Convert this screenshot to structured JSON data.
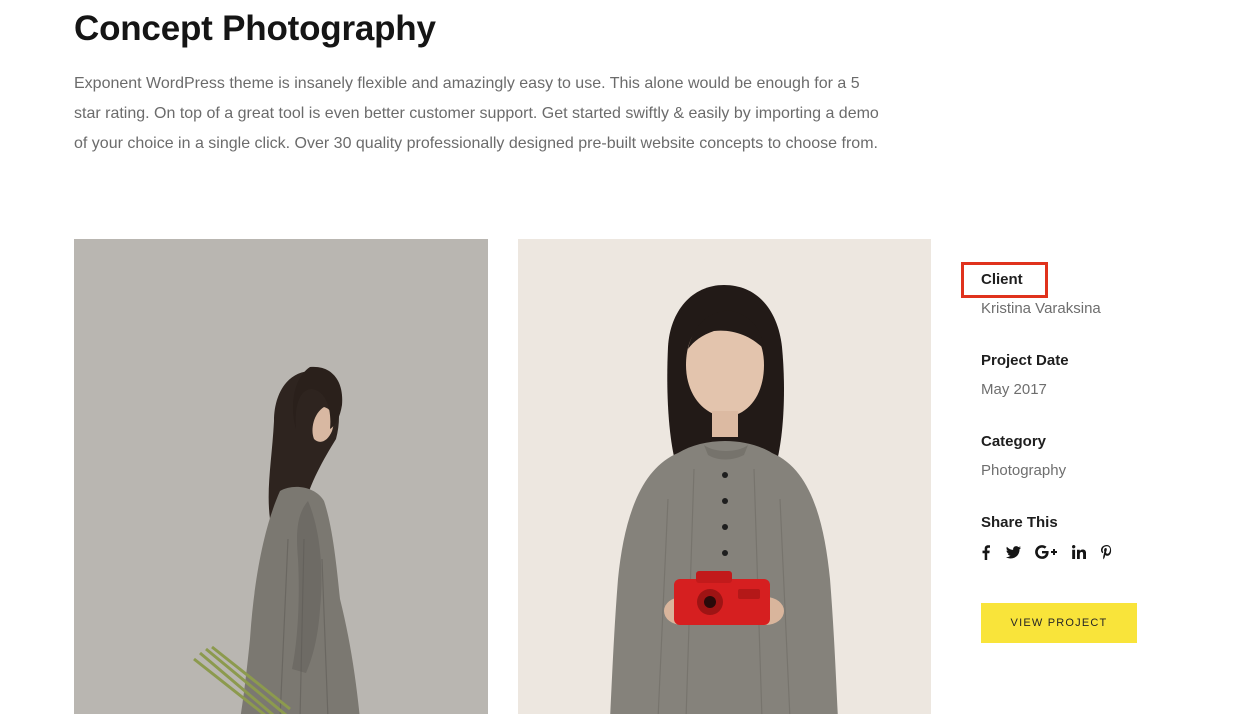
{
  "page": {
    "title": "Concept Photography",
    "intro": "Exponent WordPress theme is insanely flexible and amazingly easy to use. This alone would be enough for a 5 star rating. On top of a great tool is even better customer support. Get started swiftly & easily by importing a demo of your choice in a single click.  Over 30 quality professionally designed pre-built website concepts to choose from."
  },
  "gallery": {
    "photos": [
      {
        "subject": "woman-in-grey-dress-holding-stems"
      },
      {
        "subject": "woman-in-grey-dress-holding-red-camera"
      }
    ]
  },
  "details": {
    "client_label": "Client",
    "client_value": "Kristina Varaksina",
    "date_label": "Project Date",
    "date_value": "May 2017",
    "category_label": "Category",
    "category_value": "Photography",
    "share_label": "Share This",
    "share_icons": [
      "facebook-icon",
      "twitter-icon",
      "google-plus-icon",
      "linkedin-icon",
      "pinterest-icon"
    ]
  },
  "actions": {
    "view_project_label": "VIEW PROJECT"
  },
  "colors": {
    "highlight": "#e0321d",
    "button": "#f9e43a"
  }
}
